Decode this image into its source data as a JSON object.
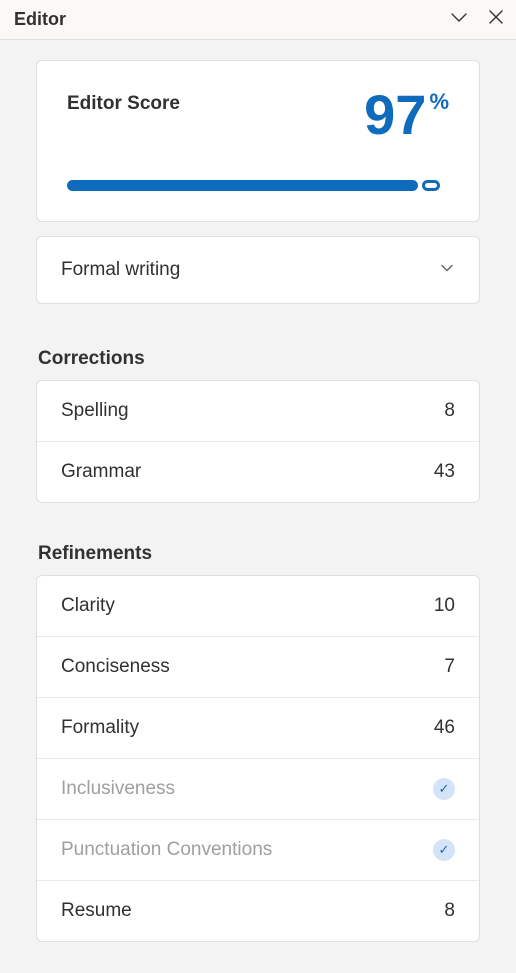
{
  "header": {
    "title": "Editor"
  },
  "score": {
    "label": "Editor Score",
    "value": "97",
    "percent_symbol": "%"
  },
  "style_dropdown": {
    "selected": "Formal writing"
  },
  "corrections": {
    "title": "Corrections",
    "items": [
      {
        "label": "Spelling",
        "value": "8",
        "done": false
      },
      {
        "label": "Grammar",
        "value": "43",
        "done": false
      }
    ]
  },
  "refinements": {
    "title": "Refinements",
    "items": [
      {
        "label": "Clarity",
        "value": "10",
        "done": false
      },
      {
        "label": "Conciseness",
        "value": "7",
        "done": false
      },
      {
        "label": "Formality",
        "value": "46",
        "done": false
      },
      {
        "label": "Inclusiveness",
        "value": "",
        "done": true
      },
      {
        "label": "Punctuation Conventions",
        "value": "",
        "done": true
      },
      {
        "label": "Resume",
        "value": "8",
        "done": false
      }
    ]
  }
}
